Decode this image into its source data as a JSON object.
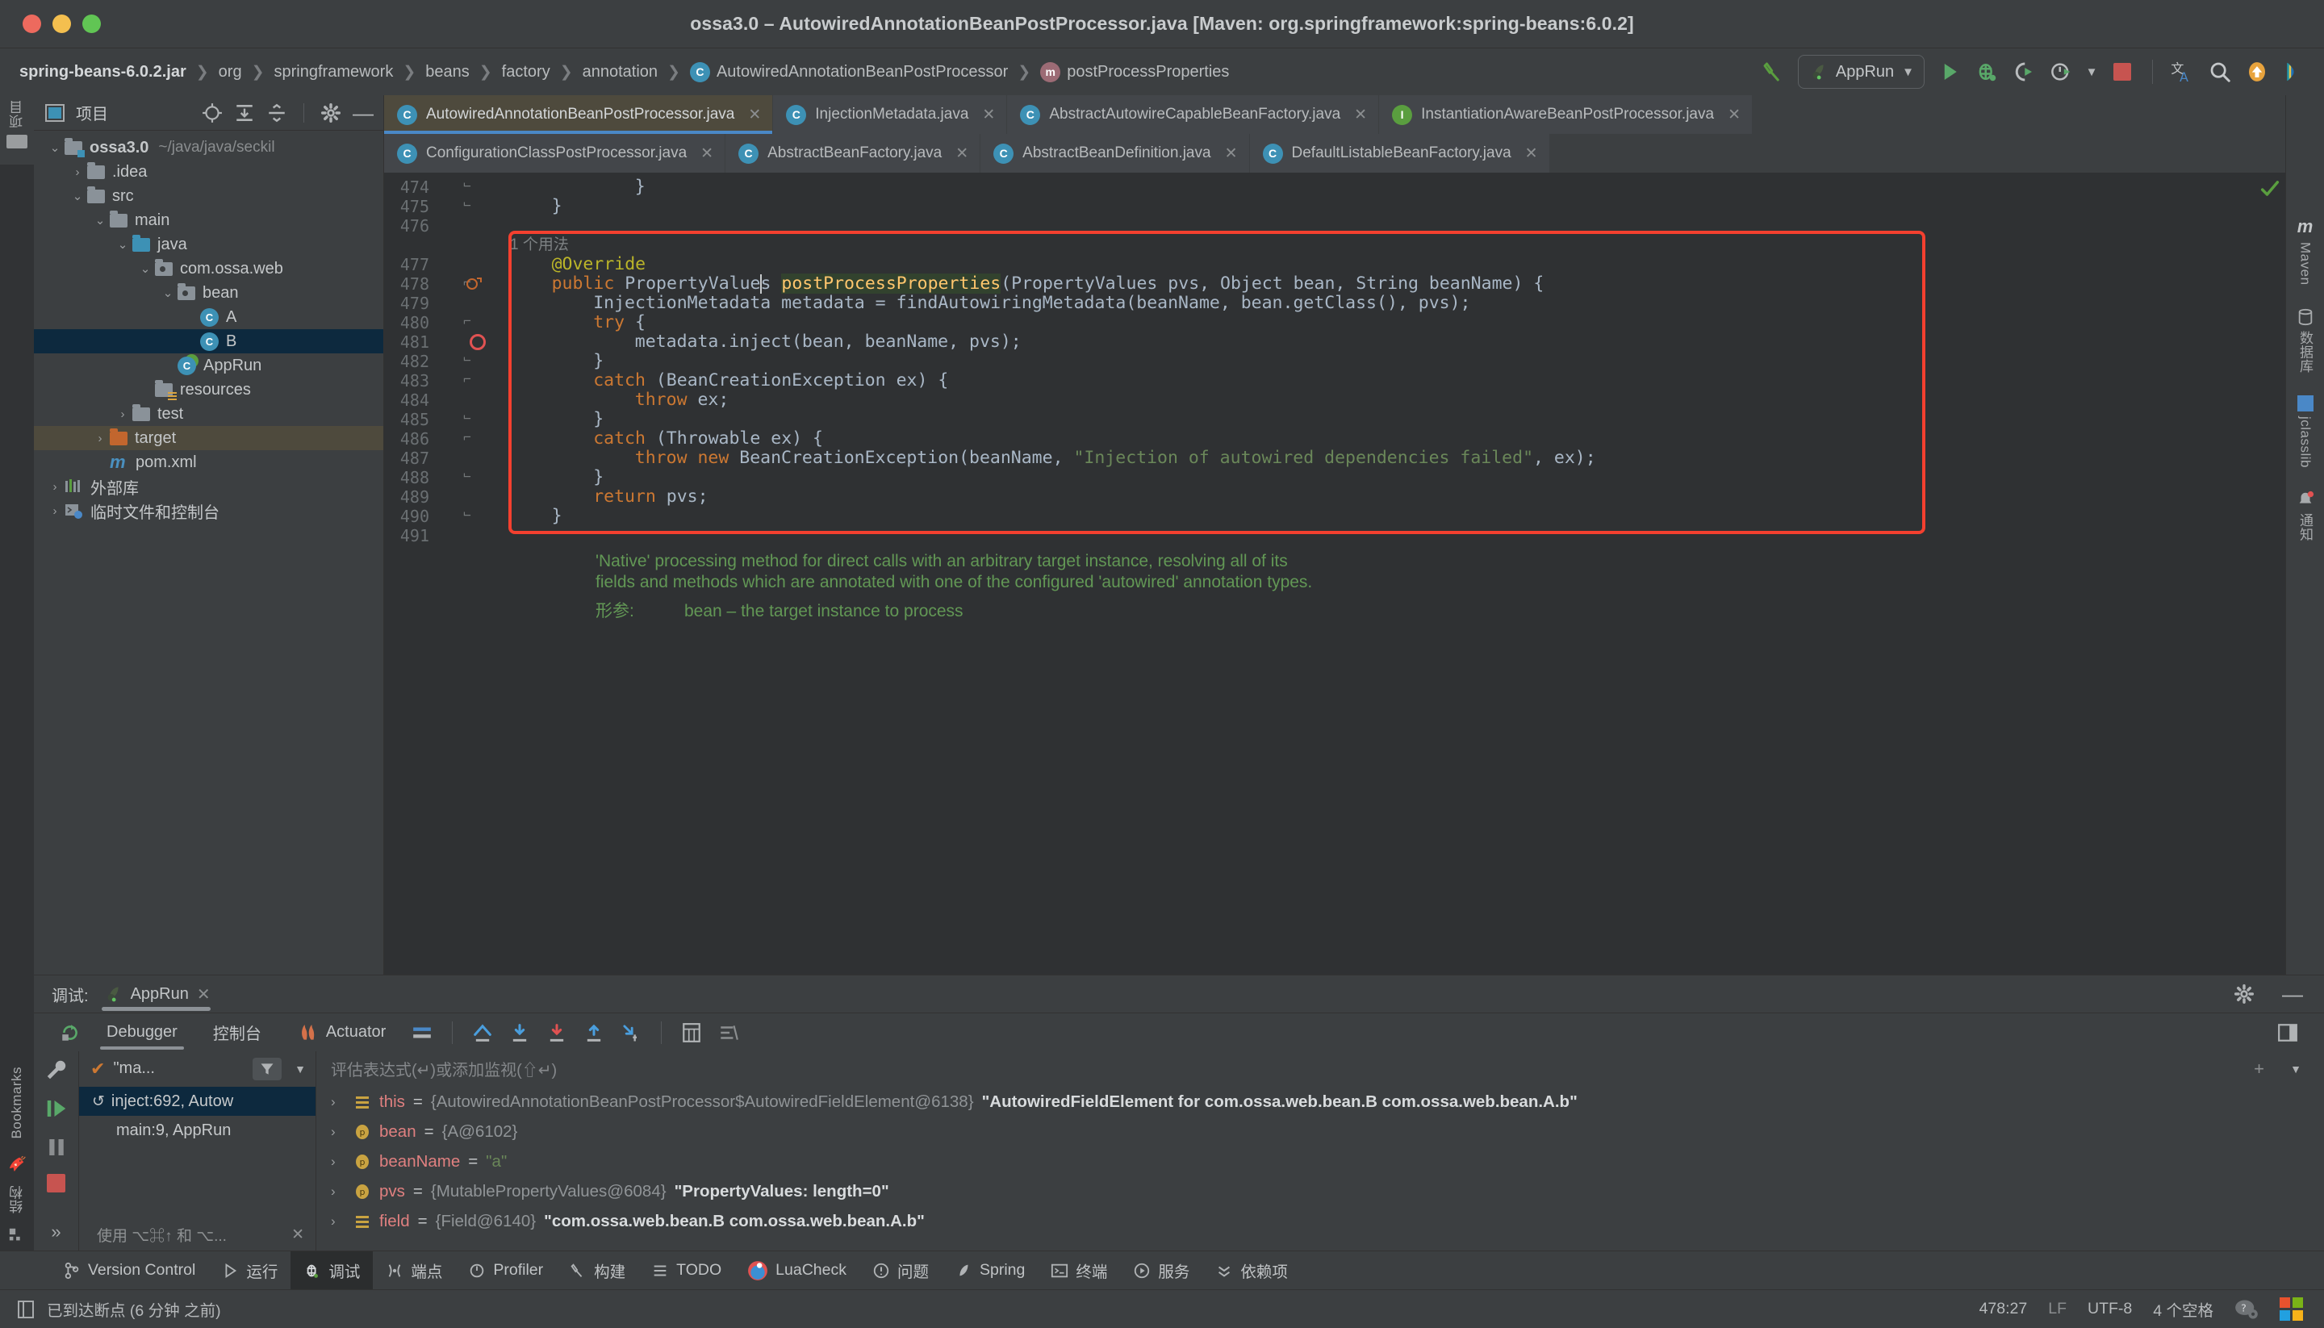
{
  "window": {
    "title": "ossa3.0 – AutowiredAnnotationBeanPostProcessor.java [Maven: org.springframework:spring-beans:6.0.2]"
  },
  "breadcrumb": [
    {
      "label": "spring-beans-6.0.2.jar",
      "icon": null,
      "bold": true
    },
    {
      "label": "org",
      "icon": null,
      "bold": false
    },
    {
      "label": "springframework",
      "icon": null,
      "bold": false
    },
    {
      "label": "beans",
      "icon": null,
      "bold": false
    },
    {
      "label": "factory",
      "icon": null,
      "bold": false
    },
    {
      "label": "annotation",
      "icon": null,
      "bold": false
    },
    {
      "label": "AutowiredAnnotationBeanPostProcessor",
      "icon": "class-icon",
      "bold": false
    },
    {
      "label": "postProcessProperties",
      "icon": "method-icon",
      "bold": false
    }
  ],
  "toolbar": {
    "build_icon": "hammer-icon",
    "run_config": "AppRun",
    "run_icon": "run-icon",
    "debug_icon": "debug-icon",
    "run_coverage_icon": "run-with-coverage-icon",
    "profiler_icon": "profiler-icon",
    "stop_icon": "stop-icon",
    "translate_icon": "translate-icon",
    "search_icon": "search-icon",
    "update_icon": "update-arrow-icon",
    "ai_icon": "ai-assistant-icon"
  },
  "editor_tabs": {
    "row1": [
      {
        "label": "AutowiredAnnotationBeanPostProcessor.java",
        "icon": "class-icon",
        "active": true
      },
      {
        "label": "InjectionMetadata.java",
        "icon": "class-icon",
        "active": false
      },
      {
        "label": "AbstractAutowireCapableBeanFactory.java",
        "icon": "abstract-class-icon",
        "active": false
      },
      {
        "label": "InstantiationAwareBeanPostProcessor.java",
        "icon": "interface-icon",
        "active": false
      }
    ],
    "row2": [
      {
        "label": "ConfigurationClassPostProcessor.java",
        "icon": "class-icon",
        "active": false
      },
      {
        "label": "AbstractBeanFactory.java",
        "icon": "abstract-class-icon",
        "active": false
      },
      {
        "label": "AbstractBeanDefinition.java",
        "icon": "abstract-class-icon",
        "active": false
      },
      {
        "label": "DefaultListableBeanFactory.java",
        "icon": "class-icon",
        "active": false
      }
    ],
    "close_glyph": "✕",
    "more_icon": "more-vertical-icon"
  },
  "left_strip": {
    "project_label": "项目",
    "bookmarks_label": "Bookmarks",
    "structure_label": "结构"
  },
  "right_strip": {
    "items": [
      "Maven",
      "数据库",
      "jclasslib",
      "通知"
    ]
  },
  "project_panel": {
    "title": "项目",
    "locate_icon": "locate-icon",
    "expand_icon": "expand-all-icon",
    "collapse_icon": "collapse-all-icon",
    "settings_icon": "gear-icon",
    "hide_icon": "minimize-icon",
    "tree": [
      {
        "label": "ossa3.0",
        "path": "~/java/java/seckil",
        "depth": 0,
        "arrow": "down",
        "icon": "module-folder",
        "bold": true,
        "sel": null
      },
      {
        "label": ".idea",
        "path": "",
        "depth": 1,
        "arrow": "right",
        "icon": "folder",
        "bold": false,
        "sel": null
      },
      {
        "label": "src",
        "path": "",
        "depth": 1,
        "arrow": "down",
        "icon": "folder",
        "bold": false,
        "sel": null
      },
      {
        "label": "main",
        "path": "",
        "depth": 2,
        "arrow": "down",
        "icon": "folder",
        "bold": false,
        "sel": null
      },
      {
        "label": "java",
        "path": "",
        "depth": 3,
        "arrow": "down",
        "icon": "source-folder",
        "bold": false,
        "sel": null
      },
      {
        "label": "com.ossa.web",
        "path": "",
        "depth": 4,
        "arrow": "down",
        "icon": "package",
        "bold": false,
        "sel": null
      },
      {
        "label": "bean",
        "path": "",
        "depth": 5,
        "arrow": "down",
        "icon": "package",
        "bold": false,
        "sel": null
      },
      {
        "label": "A",
        "path": "",
        "depth": 6,
        "arrow": "none",
        "icon": "class",
        "bold": false,
        "sel": null
      },
      {
        "label": "B",
        "path": "",
        "depth": 6,
        "arrow": "none",
        "icon": "class",
        "bold": false,
        "sel": "blue"
      },
      {
        "label": "AppRun",
        "path": "",
        "depth": 5,
        "arrow": "none",
        "icon": "runnable-class",
        "bold": false,
        "sel": null
      },
      {
        "label": "resources",
        "path": "",
        "depth": 4,
        "arrow": "none",
        "icon": "resource-folder",
        "bold": false,
        "sel": null
      },
      {
        "label": "test",
        "path": "",
        "depth": 3,
        "arrow": "right",
        "icon": "folder",
        "bold": false,
        "sel": null
      },
      {
        "label": "target",
        "path": "",
        "depth": 2,
        "arrow": "right",
        "icon": "excluded-folder",
        "bold": false,
        "sel": "tan"
      },
      {
        "label": "pom.xml",
        "path": "",
        "depth": 2,
        "arrow": "none",
        "icon": "maven",
        "bold": false,
        "sel": null
      },
      {
        "label": "外部库",
        "path": "",
        "depth": 0,
        "arrow": "right",
        "icon": "library",
        "bold": false,
        "sel": null
      },
      {
        "label": "临时文件和控制台",
        "path": "",
        "depth": 0,
        "arrow": "right",
        "icon": "scratches",
        "bold": false,
        "sel": null
      }
    ]
  },
  "editor": {
    "usage_hint": "1 个用法",
    "lines": [
      {
        "num": "474",
        "indent": 3,
        "fold": "end",
        "tokens": [
          {
            "t": "}",
            "c": "txt"
          }
        ]
      },
      {
        "num": "475",
        "indent": 1,
        "fold": "end",
        "tokens": [
          {
            "t": "}",
            "c": "txt"
          }
        ]
      },
      {
        "num": "476",
        "indent": 0,
        "fold": "",
        "tokens": []
      },
      {
        "num": "477",
        "indent": 1,
        "fold": "",
        "tokens": [
          {
            "t": "@Override",
            "c": "ann"
          }
        ]
      },
      {
        "num": "478",
        "indent": 1,
        "fold": "start",
        "tokens": [
          {
            "t": "public ",
            "c": "kw"
          },
          {
            "t": "PropertyValues ",
            "c": "txt"
          },
          {
            "t": "postProcessProperties",
            "c": "mname hl"
          },
          {
            "t": "(PropertyValues pvs, Object bean, String beanName) {",
            "c": "txt"
          }
        ]
      },
      {
        "num": "479",
        "indent": 2,
        "fold": "",
        "tokens": [
          {
            "t": "InjectionMetadata metadata = findAutowiringMetadata(beanName, bean.getClass(), pvs);",
            "c": "txt"
          }
        ]
      },
      {
        "num": "480",
        "indent": 2,
        "fold": "start",
        "tokens": [
          {
            "t": "try ",
            "c": "kw"
          },
          {
            "t": "{",
            "c": "txt"
          }
        ]
      },
      {
        "num": "481",
        "indent": 3,
        "fold": "",
        "tokens": [
          {
            "t": "metadata.inject(bean, beanName, pvs);",
            "c": "txt"
          }
        ]
      },
      {
        "num": "482",
        "indent": 2,
        "fold": "end",
        "tokens": [
          {
            "t": "}",
            "c": "txt"
          }
        ]
      },
      {
        "num": "483",
        "indent": 2,
        "fold": "start",
        "tokens": [
          {
            "t": "catch ",
            "c": "kw"
          },
          {
            "t": "(BeanCreationException ex) {",
            "c": "txt"
          }
        ]
      },
      {
        "num": "484",
        "indent": 3,
        "fold": "",
        "tokens": [
          {
            "t": "throw ",
            "c": "kw"
          },
          {
            "t": "ex;",
            "c": "txt"
          }
        ]
      },
      {
        "num": "485",
        "indent": 2,
        "fold": "end",
        "tokens": [
          {
            "t": "}",
            "c": "txt"
          }
        ]
      },
      {
        "num": "486",
        "indent": 2,
        "fold": "start",
        "tokens": [
          {
            "t": "catch ",
            "c": "kw"
          },
          {
            "t": "(Throwable ex) {",
            "c": "txt"
          }
        ]
      },
      {
        "num": "487",
        "indent": 3,
        "fold": "",
        "tokens": [
          {
            "t": "throw new ",
            "c": "kw"
          },
          {
            "t": "BeanCreationException(beanName, ",
            "c": "txt"
          },
          {
            "t": "\"Injection of autowired dependencies failed\"",
            "c": "str"
          },
          {
            "t": ", ex);",
            "c": "txt"
          }
        ]
      },
      {
        "num": "488",
        "indent": 2,
        "fold": "end",
        "tokens": [
          {
            "t": "}",
            "c": "txt"
          }
        ]
      },
      {
        "num": "489",
        "indent": 2,
        "fold": "",
        "tokens": [
          {
            "t": "return ",
            "c": "kw"
          },
          {
            "t": "pvs;",
            "c": "txt"
          }
        ]
      },
      {
        "num": "490",
        "indent": 1,
        "fold": "end",
        "tokens": [
          {
            "t": "}",
            "c": "txt"
          }
        ]
      },
      {
        "num": "491",
        "indent": 0,
        "fold": "",
        "tokens": []
      }
    ],
    "javadoc": [
      "'Native' processing method for direct calls with an arbitrary target instance, resolving all of its",
      "fields and methods which are annotated with one of the configured 'autowired' annotation types."
    ],
    "javadoc_params_label": "形参:",
    "javadoc_param": "bean – the target instance to process",
    "breakpoint_line": "481",
    "current_line": "478",
    "highlight_color": "#f4402f"
  },
  "debug_panel": {
    "header_label": "调试:",
    "session_name": "AppRun",
    "close_glyph": "✕",
    "settings_icon": "gear-icon",
    "hide_icon": "minimize-icon",
    "layout_icon": "layout-icon",
    "rerun_icon": "rerun-icon",
    "tabs": [
      {
        "label": "Debugger",
        "active": true,
        "icon": null
      },
      {
        "label": "控制台",
        "active": false,
        "icon": null
      },
      {
        "label": "Actuator",
        "active": false,
        "icon": "actuator-icon"
      }
    ],
    "step_icons": [
      "show-execution-point-icon",
      "step-over-icon",
      "step-into-icon",
      "force-step-into-icon",
      "step-out-icon",
      "run-to-cursor-icon",
      "evaluate-icon",
      "mute-breakpoints-icon"
    ],
    "rail_icons": [
      "wrench-icon",
      "resume-icon",
      "pause-icon",
      "stop-icon",
      "more-icon"
    ],
    "frames": {
      "thread_label": "\"ma...",
      "filter_icon": "filter-icon",
      "dropdown_icon": "chevron-down-icon",
      "items": [
        {
          "label": "inject:692, Autow",
          "selected": true,
          "icon": "frame-icon"
        },
        {
          "label": "main:9, AppRun",
          "selected": false,
          "icon": null
        }
      ],
      "footer_hint": "使用 ⌥⌘↑ 和 ⌥...",
      "footer_close": "✕"
    },
    "variables": {
      "placeholder": "评估表达式(↵)或添加监视(⇧↵)",
      "add_icon": "add-watch-icon",
      "menu_icon": "chevron-down-icon",
      "rows": [
        {
          "name": "this",
          "icon": "field-icon",
          "obj": "{AutowiredAnnotationBeanPostProcessor$AutowiredFieldElement@6138}",
          "str": "\"AutowiredFieldElement for com.ossa.web.bean.B com.ossa.web.bean.A.b\"",
          "strtype": "plain"
        },
        {
          "name": "bean",
          "icon": "param-icon",
          "obj": "{A@6102}",
          "str": "",
          "strtype": "plain"
        },
        {
          "name": "beanName",
          "icon": "param-icon",
          "obj": "",
          "str": "\"a\"",
          "strtype": "green"
        },
        {
          "name": "pvs",
          "icon": "param-icon",
          "obj": "{MutablePropertyValues@6084}",
          "str": "\"PropertyValues: length=0\"",
          "strtype": "plain"
        },
        {
          "name": "field",
          "icon": "field-icon",
          "obj": "{Field@6140}",
          "str": "\"com.ossa.web.bean.B com.ossa.web.bean.A.b\"",
          "strtype": "plain"
        }
      ]
    }
  },
  "bottom_bar": {
    "items": [
      {
        "label": "Version Control",
        "icon": "vcs-icon",
        "active": false
      },
      {
        "label": "运行",
        "icon": "run-icon",
        "active": false
      },
      {
        "label": "调试",
        "icon": "debug-icon",
        "active": true
      },
      {
        "label": "端点",
        "icon": "endpoints-icon",
        "active": false
      },
      {
        "label": "Profiler",
        "icon": "profiler-icon",
        "active": false
      },
      {
        "label": "构建",
        "icon": "build-icon",
        "active": false
      },
      {
        "label": "TODO",
        "icon": "todo-icon",
        "active": false
      },
      {
        "label": "LuaCheck",
        "icon": "luacheck-icon",
        "active": false
      },
      {
        "label": "问题",
        "icon": "problems-icon",
        "active": false
      },
      {
        "label": "Spring",
        "icon": "spring-icon",
        "active": false
      },
      {
        "label": "终端",
        "icon": "terminal-icon",
        "active": false
      },
      {
        "label": "服务",
        "icon": "services-icon",
        "active": false
      },
      {
        "label": "依赖项",
        "icon": "dependencies-icon",
        "active": false
      }
    ]
  },
  "status_bar": {
    "message": "已到达断点 (6 分钟 之前)",
    "message_icon": "breakpoint-reached-icon",
    "caret_position": "478:27",
    "line_separator": "LF",
    "encoding": "UTF-8",
    "indent": "4 个空格",
    "help_icon": "help-gear-icon",
    "windows_icon": "windows-logo-icon"
  },
  "colors": {
    "accent_blue": "#4a88c7",
    "highlight_red": "#f4402f",
    "selection_blue": "#0d293e",
    "selection_tan": "#4e4a3d",
    "keyword_orange": "#cc7832",
    "string_green": "#6a8759",
    "method_yellow": "#ffc66d",
    "annotation_olive": "#bbb529",
    "doc_green": "#629755"
  }
}
